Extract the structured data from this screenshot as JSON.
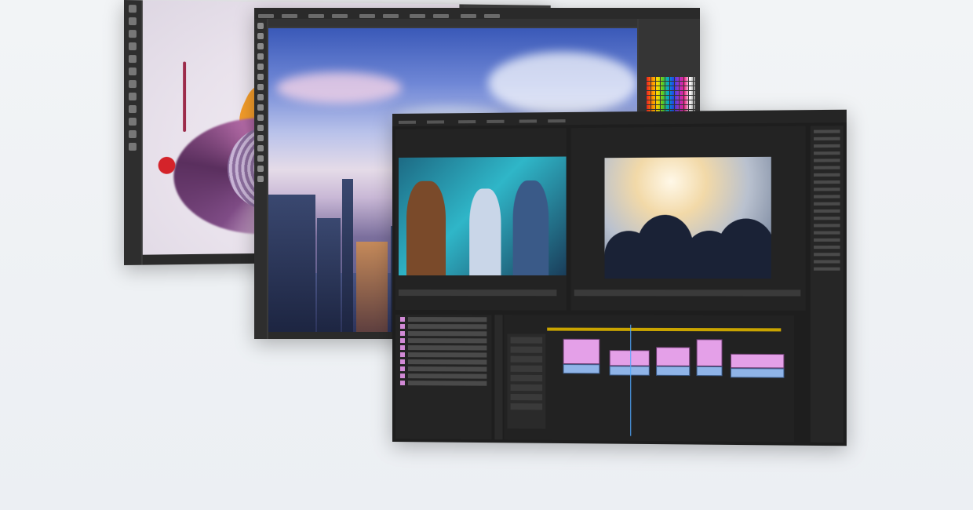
{
  "scene": {
    "background": "#eef1f4"
  },
  "windows": [
    {
      "id": "back",
      "app": "photoshop",
      "content": "abstract-paint-swirl"
    },
    {
      "id": "middle",
      "app": "photoshop",
      "content": "city-skyline-clouds"
    },
    {
      "id": "front",
      "app": "premiere",
      "content": "video-editing-timeline"
    }
  ],
  "colors": {
    "app_dark": "#1e1e1e",
    "clip_pink": "#e4a0e8",
    "clip_blue": "#8fb4e8",
    "timeline_ruler": "#c9a400",
    "playhead": "#4ea8ff"
  },
  "icons": [
    "tool-icon",
    "swatch-icon"
  ]
}
